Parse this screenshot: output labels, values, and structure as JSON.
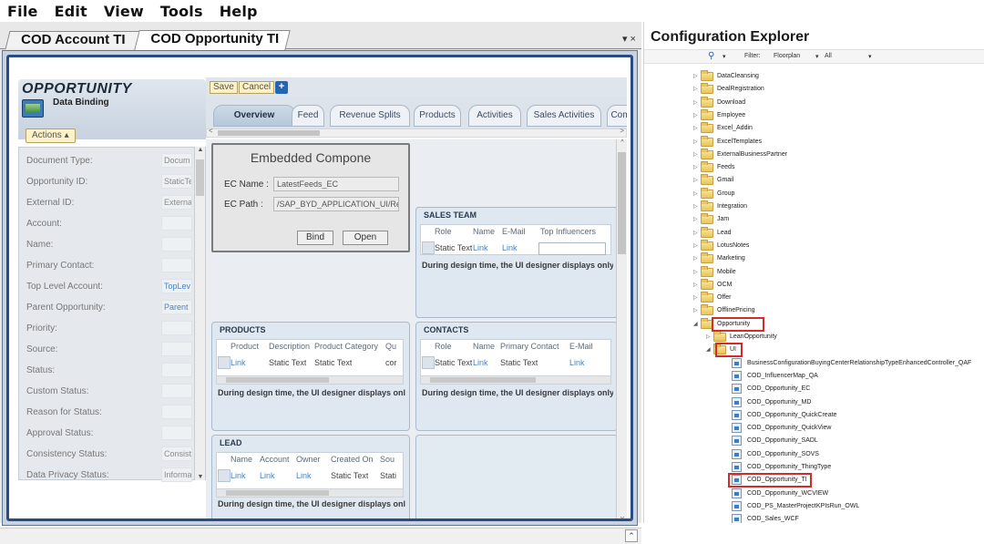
{
  "menu": [
    "File",
    "Edit",
    "View",
    "Tools",
    "Help"
  ],
  "doc_tabs": [
    "COD Account TI",
    "COD Opportunity TI"
  ],
  "tab_controls": "▾ ×",
  "left": {
    "title": "OPPORTUNITY",
    "subtitle": "Data Binding",
    "actions_label": "Actions ▴",
    "fields": [
      {
        "label": "Document Type:",
        "value": "Docum"
      },
      {
        "label": "Opportunity ID:",
        "value": "StaticTe"
      },
      {
        "label": "External ID:",
        "value": "Externa"
      },
      {
        "label": "Account:",
        "value": ""
      },
      {
        "label": "Name:",
        "value": ""
      },
      {
        "label": "Primary Contact:",
        "value": ""
      },
      {
        "label": "Top Level Account:",
        "value": "TopLev"
      },
      {
        "label": "Parent Opportunity:",
        "value": "Parent"
      },
      {
        "label": "Priority:",
        "value": ""
      },
      {
        "label": "Source:",
        "value": ""
      },
      {
        "label": "Status:",
        "value": ""
      },
      {
        "label": "Custom Status:",
        "value": ""
      },
      {
        "label": "Reason for Status:",
        "value": ""
      },
      {
        "label": "Approval Status:",
        "value": ""
      },
      {
        "label": "Consistency Status:",
        "value": "Consist"
      },
      {
        "label": "Data Privacy Status:",
        "value": "Informa"
      }
    ]
  },
  "toolbar": {
    "save": "Save",
    "cancel": "Cancel",
    "add": "+"
  },
  "tabs": [
    "Overview",
    "Feed",
    "Revenue Splits",
    "Products",
    "Activities",
    "Sales Activities",
    "Com"
  ],
  "embedded": {
    "title": "Embedded Compone",
    "ec_name_label": "EC Name :",
    "ec_name": "LatestFeeds_EC",
    "ec_path_label": "EC Path :",
    "ec_path": "/SAP_BYD_APPLICATION_UI/Reuse",
    "bind": "Bind",
    "open": "Open"
  },
  "design_note": "During design time, the UI designer displays only o",
  "sales_team": {
    "title": "SALES TEAM",
    "headers": [
      "Role",
      "Name",
      "E-Mail",
      "Top Influencers"
    ],
    "row": [
      "Static Text",
      "Link",
      "Link"
    ]
  },
  "products": {
    "title": "PRODUCTS",
    "headers": [
      "Product",
      "Description",
      "Product Category",
      "Qu"
    ],
    "row": [
      "Link",
      "Static Text",
      "Static Text",
      "cor"
    ]
  },
  "contacts": {
    "title": "CONTACTS",
    "headers": [
      "Role",
      "Name",
      "Primary Contact",
      "E-Mail"
    ],
    "row": [
      "Static Text",
      "Link",
      "Static Text",
      "Link"
    ]
  },
  "lead": {
    "title": "LEAD",
    "headers": [
      "Name",
      "Account",
      "Owner",
      "Created On",
      "Sou"
    ],
    "row": [
      "Link",
      "Link",
      "Link",
      "Static Text",
      "Stati"
    ]
  },
  "explorer": {
    "title": "Configuration Explorer",
    "filter_label": "Filter:",
    "filter_value": "Floorplan",
    "filter_all": "All",
    "folders": [
      "DataCleansing",
      "DealRegistration",
      "Download",
      "Employee",
      "Excel_Addin",
      "ExcelTemplates",
      "ExternalBusinessPartner",
      "Feeds",
      "Gmail",
      "Group",
      "Integration",
      "Jam",
      "Lead",
      "LotusNotes",
      "Marketing",
      "Mobile",
      "OCM",
      "Offer",
      "OfflinePricing",
      "Opportunity"
    ],
    "sub_lean": "LeanOpportunity",
    "sub_ui": "UI",
    "files": [
      "BusinessConfigurationBuyingCenterRelationshipTypeEnhancedController_QAF",
      "COD_InfluencerMap_QA",
      "COD_Opportunity_EC",
      "COD_Opportunity_MD",
      "COD_Opportunity_QuickCreate",
      "COD_Opportunity_QuickView",
      "COD_Opportunity_SADL",
      "COD_Opportunity_SOVS",
      "COD_Opportunity_ThingType",
      "COD_Opportunity_TI",
      "COD_Opportunity_WCVIEW",
      "COD_PS_MasterProjectKPIsRun_OWL",
      "COD_Sales_WCF"
    ]
  }
}
